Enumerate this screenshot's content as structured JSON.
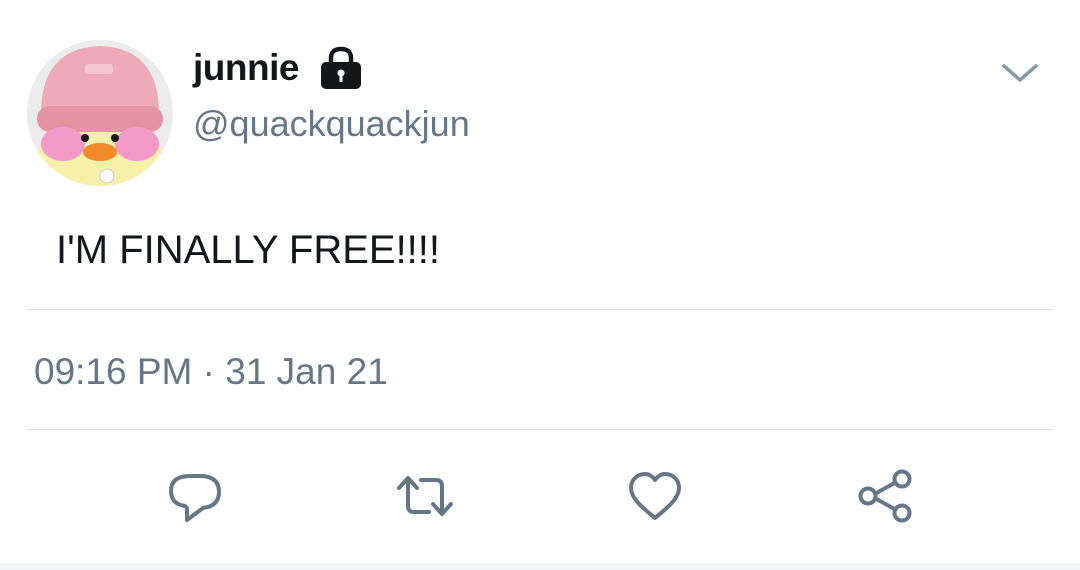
{
  "tweet": {
    "display_name": "junnie",
    "handle": "@quackquackjun",
    "text": "I'M FINALLY FREE!!!!",
    "timestamp": "09:16 PM · 31 Jan 21",
    "protected_icon": "lock-icon",
    "avatar": "profile photo of a yellow duck plush wearing a pink knit hat"
  },
  "actions": [
    {
      "name": "reply",
      "icon": "reply-icon"
    },
    {
      "name": "retweet",
      "icon": "retweet-icon"
    },
    {
      "name": "like",
      "icon": "heart-icon"
    },
    {
      "name": "share",
      "icon": "share-icon"
    }
  ],
  "colors": {
    "text_primary": "#14171a",
    "text_secondary": "#657786",
    "icon": "#657786",
    "divider": "#dfe3e7"
  }
}
